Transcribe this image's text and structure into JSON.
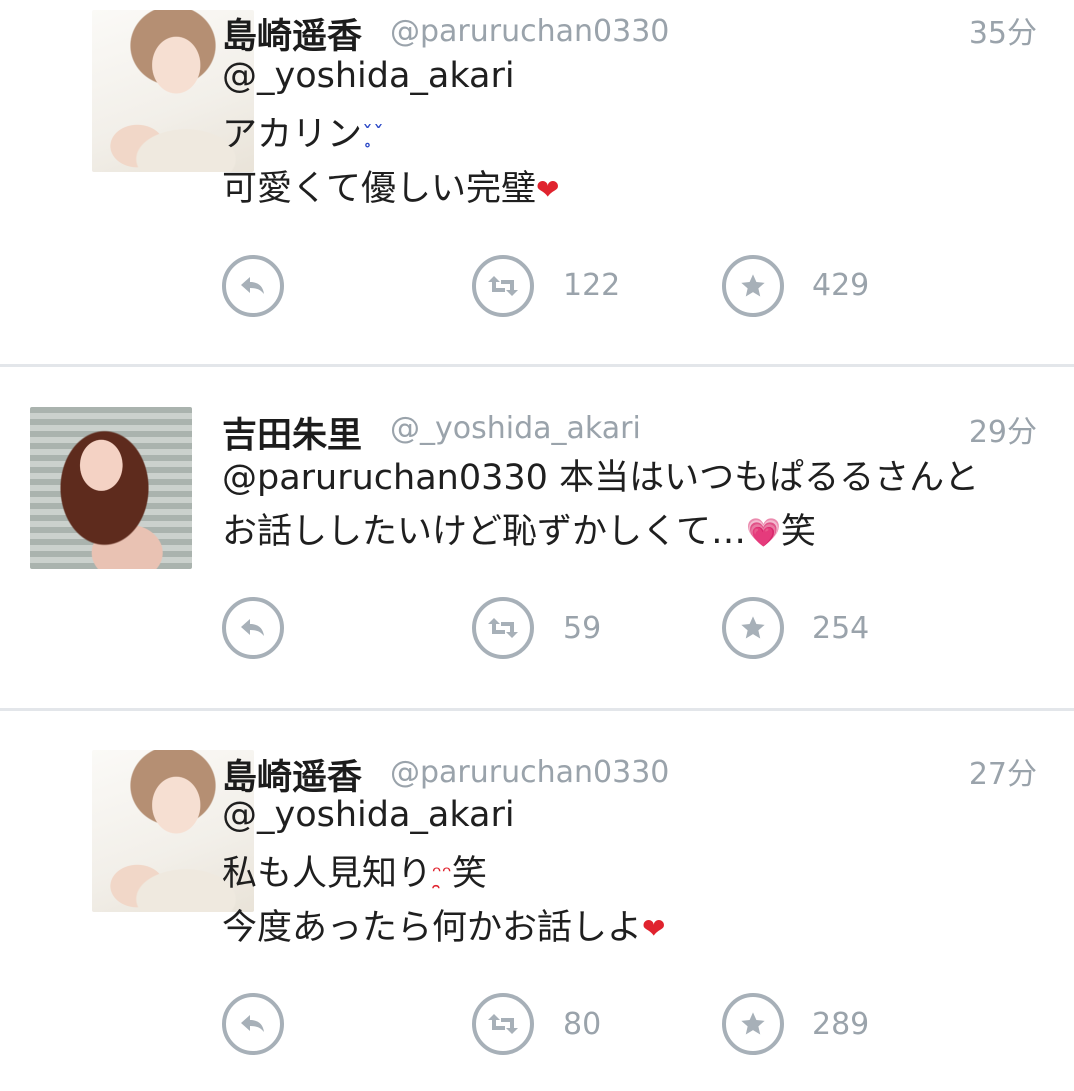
{
  "tweets": [
    {
      "name": "島崎遥香",
      "handle": "@paruruchan0330",
      "time": "35分",
      "lines": [
        "@_yoshida_akari",
        "アカリン",
        "可愛くて優しい完璧"
      ],
      "retweets": "122",
      "likes": "429"
    },
    {
      "name": "吉田朱里",
      "handle": "@_yoshida_akari",
      "time": "29分",
      "lines": [
        "@paruruchan0330 本当はいつもぱるるさんと",
        "お話ししたいけど恥ずかしくて…",
        "笑"
      ],
      "retweets": "59",
      "likes": "254"
    },
    {
      "name": "島崎遥香",
      "handle": "@paruruchan0330",
      "time": "27分",
      "lines": [
        "@_yoshida_akari",
        "私も人見知り",
        "笑",
        "今度あったら何かお話しよ"
      ],
      "retweets": "80",
      "likes": "289"
    }
  ],
  "icons": {
    "reply": "reply-icon",
    "retweet": "retweet-icon",
    "like": "star-icon",
    "emoji_sweat": "sweat-face-icon",
    "emoji_heart": "heart-icon",
    "emoji_pout": "pout-face-icon"
  },
  "colors": {
    "icon_gray": "#a7b0b8",
    "meta_gray": "#9aa3ab",
    "text": "#1f1f1f",
    "heart_red": "#e0232e",
    "heart_pink": "#e25bd7"
  }
}
